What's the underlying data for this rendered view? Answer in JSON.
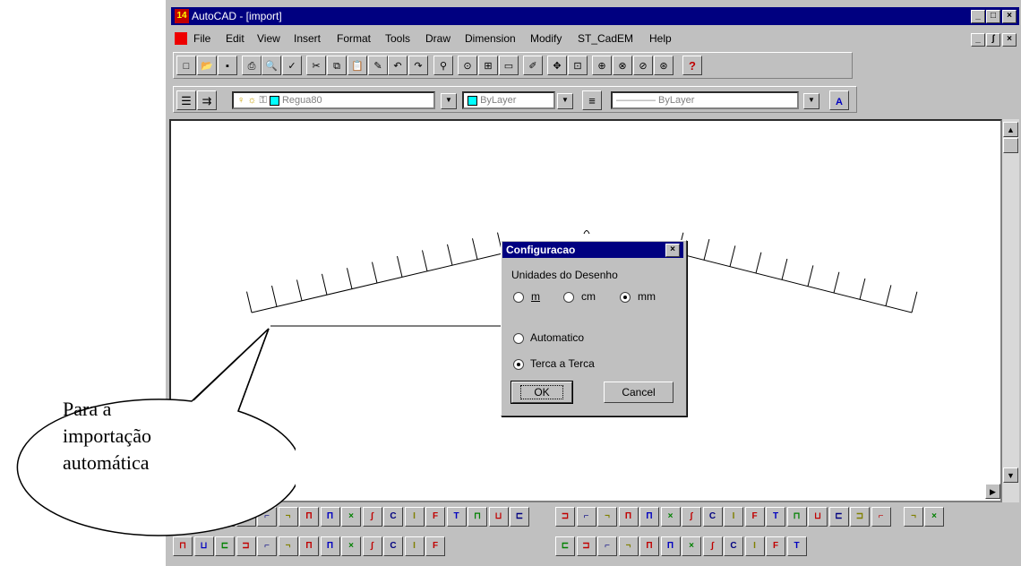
{
  "window": {
    "app_icon": "14",
    "title": "AutoCAD - [import]",
    "controls": [
      "_",
      "□",
      "×"
    ],
    "doc_controls": [
      "_",
      "ʃ",
      "×"
    ]
  },
  "menu": {
    "items": [
      "File",
      "Edit",
      "View",
      "Insert",
      "Format",
      "Tools",
      "Draw",
      "Dimension",
      "Modify",
      "ST_CadEM",
      "Help"
    ]
  },
  "toolbar_standard": {
    "icons": [
      "new-icon",
      "open-icon",
      "save-icon",
      "print-icon",
      "preview-icon",
      "spell-icon",
      "cut-icon",
      "copy-icon",
      "paste-icon",
      "match-icon",
      "undo-icon",
      "redo-icon",
      "web-icon",
      "snap-icon",
      "link-icon",
      "insert-icon",
      "pencil-icon",
      "pan-icon",
      "aerial-icon",
      "zoom-realtime-icon",
      "zoom-window-icon",
      "zoom-prev-icon",
      "zoom-all-icon",
      "help-icon"
    ],
    "help_glyph": "?"
  },
  "toolbar_properties": {
    "layer_value": "Regua80",
    "color_value": "ByLayer",
    "linetype_value": "———— ByLayer",
    "accent_layer": "#00ffff"
  },
  "dialog": {
    "title": "Configuracao",
    "close": "×",
    "group_label": "Unidades do Desenho",
    "units": [
      {
        "label": "m",
        "selected": false
      },
      {
        "label": "cm",
        "selected": false
      },
      {
        "label": "mm",
        "selected": true
      }
    ],
    "options": [
      {
        "label": "Automatico",
        "selected": false
      },
      {
        "label": "Terca a Terca",
        "selected": true
      }
    ],
    "ok_label": "OK",
    "cancel_label": "Cancel"
  },
  "callout": {
    "line1": "Para a",
    "line2": "importação",
    "line3": "automática"
  },
  "colors": {
    "titlebar": "#000080",
    "face": "#c0c0c0",
    "canvas": "#ffffff"
  }
}
